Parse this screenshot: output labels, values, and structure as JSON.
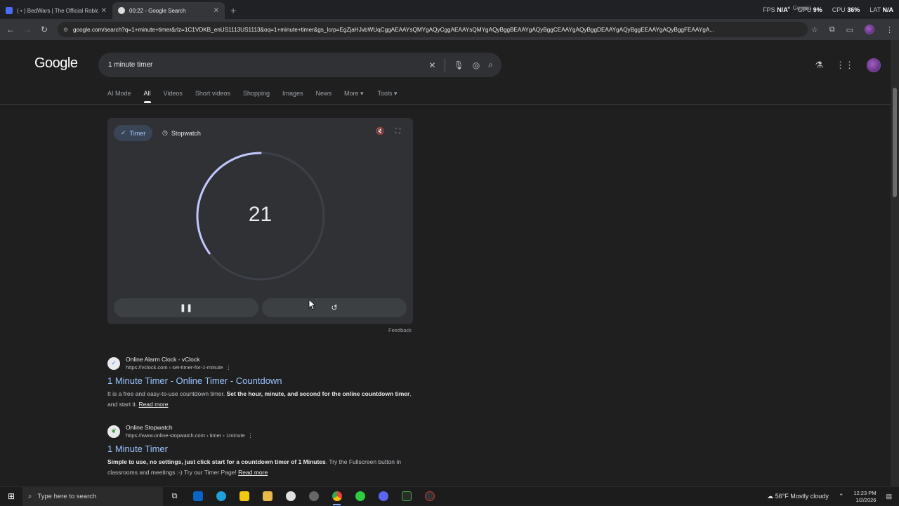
{
  "browser": {
    "tabs": [
      {
        "title": "( • ) BedWars | The Official Roblox",
        "active": false,
        "favicon_color": "#4a6cf7"
      },
      {
        "title": "00:22 - Google Search",
        "active": true,
        "favicon_color": "#dddddd"
      }
    ],
    "overlay_stats": {
      "fps_label": "FPS",
      "fps_value": "N/A",
      "gpu_label": "GPU",
      "gpu_value": "9%",
      "cpu_label": "CPU",
      "cpu_value": "36%",
      "lat_label": "LAT",
      "lat_value": "N/A",
      "gemini_label": "Gemini"
    },
    "url": "google.com/search?q=1+minute+timer&rlz=1C1VDKB_enUS1113US1113&oq=1+minute+timer&gs_lcrp=EgZjaHJvbWUqCggAEAAYsQMYgAQyCggAEAAYsQMYgAQyBggBEAAYgAQyBggCEAAYgAQyBggDEAAYgAQyBggEEAAYgAQyBggFEAAYgA..."
  },
  "google": {
    "logo": "Google",
    "query": "1 minute timer",
    "nav_tabs": [
      "AI Mode",
      "All",
      "Videos",
      "Short videos",
      "Shopping",
      "Images",
      "News",
      "More ▾",
      "Tools ▾"
    ],
    "active_tab": "All"
  },
  "timer": {
    "tab_timer": "Timer",
    "tab_stopwatch": "Stopwatch",
    "remaining_seconds": "21",
    "total_seconds": 60,
    "feedback": "Feedback",
    "ring_color": "#c2c8ff"
  },
  "results": [
    {
      "site_name": "Online Alarm Clock - vClock",
      "url": "https://vclock.com › set-timer-for-1-minute",
      "title": "1 Minute Timer - Online Timer - Countdown",
      "snippet_plain": "It is a free and easy-to-use countdown timer.",
      "snippet_bold": "Set the hour, minute, and second for the online countdown timer",
      "snippet_tail": ", and start it.",
      "read_more": "Read more"
    },
    {
      "site_name": "Online Stopwatch",
      "url": "https://www.online-stopwatch.com › timer › 1minute",
      "title": "1 Minute Timer",
      "snippet_bold": "Simple to use, no settings, just click start for a countdown timer of 1 Minutes",
      "snippet_tail": ". Try the Fullscreen button in classrooms and meetings :-) Try our Timer Page!",
      "read_more": "Read more"
    }
  ],
  "taskbar": {
    "search_placeholder": "Type here to search",
    "weather": "56°F  Mostly cloudy",
    "time": "12:23 PM",
    "date": "1/2/2026"
  }
}
